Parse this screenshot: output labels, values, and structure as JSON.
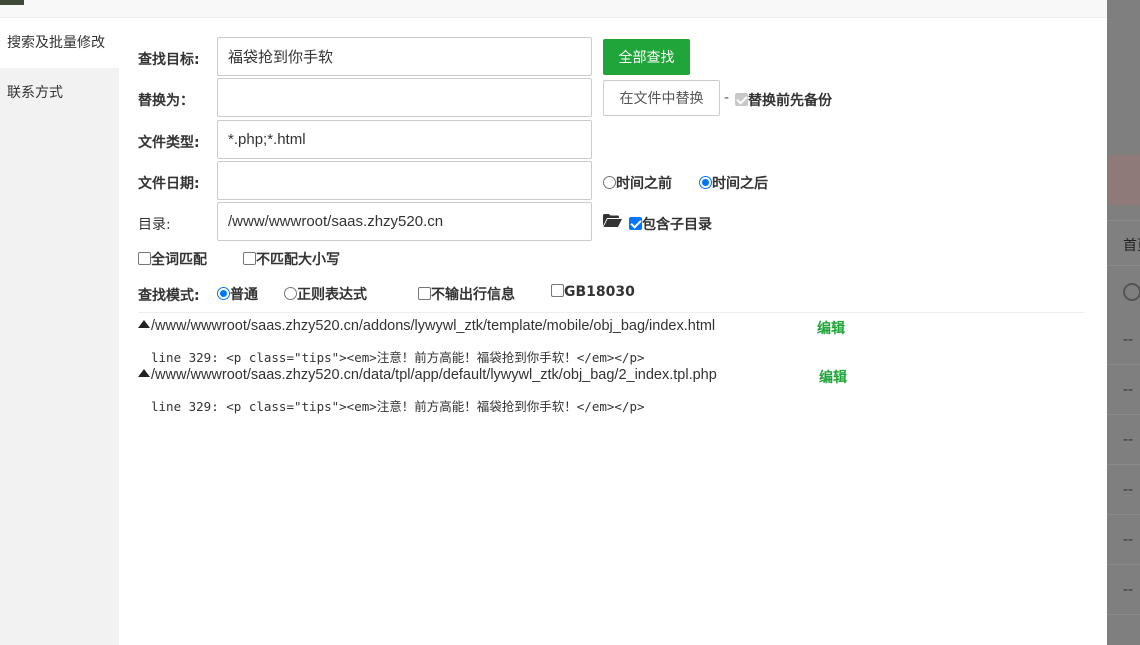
{
  "sidebar": {
    "items": [
      {
        "label": "搜索及批量修改"
      },
      {
        "label": "联系方式"
      }
    ]
  },
  "form": {
    "search_target": {
      "label": "查找目标:",
      "value": "福袋抢到你手软"
    },
    "replace_with": {
      "label": "替换为：",
      "value": ""
    },
    "file_type": {
      "label": "文件类型:",
      "value": "*.php;*.html"
    },
    "file_date": {
      "label": "文件日期:",
      "value": ""
    },
    "directory": {
      "label": "目录:",
      "value": "/www/wwwroot/saas.zhzy520.cn"
    },
    "find_all_button": "全部查找",
    "replace_in_file_button": "在文件中替换",
    "dash": "-",
    "backup_before_replace": "替换前先备份",
    "time_before": "时间之前",
    "time_after": "时间之后",
    "include_subdirs": "包含子目录",
    "whole_word": "全词匹配",
    "ignore_case": "不匹配大小写",
    "mode_label": "查找模式:",
    "mode_normal": "普通",
    "mode_regex": "正则表达式",
    "no_line_output": "不输出行信息",
    "gb18030": "GB18030"
  },
  "results": [
    {
      "path": "/www/wwwroot/saas.zhzy520.cn/addons/lywywl_ztk/template/mobile/obj_bag/index.html",
      "edit": "编辑",
      "line": "line 329: <p class=\"tips\"><em>注意！前方高能！福袋抢到你手软！</em></p>"
    },
    {
      "path": "/www/wwwroot/saas.zhzy520.cn/data/tpl/app/default/lywywl_ztk/obj_bag/2_index.tpl.php",
      "edit": "编辑",
      "line": "line 329: <p class=\"tips\"><em>注意！前方高能！福袋抢到你手软！</em></p>"
    }
  ],
  "background": {
    "header_text": "首页",
    "row_text": "--"
  },
  "colors": {
    "accent_green": "#20a53a",
    "checkbox_blue": "#0075ff"
  }
}
